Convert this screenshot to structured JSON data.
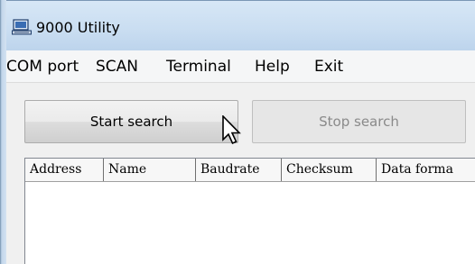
{
  "window": {
    "title": "9000 Utility"
  },
  "menu": {
    "items": [
      {
        "label": "COM port"
      },
      {
        "label": "SCAN"
      },
      {
        "label": "Terminal"
      },
      {
        "label": "Help"
      },
      {
        "label": "Exit"
      }
    ]
  },
  "toolbar": {
    "start_label": "Start search",
    "stop_label": "Stop search",
    "stop_enabled": false
  },
  "list": {
    "columns": [
      "Address",
      "Name",
      "Baudrate",
      "Checksum",
      "Data forma"
    ],
    "rows": []
  },
  "icons": {
    "app": "computer-icon",
    "cursor": "mouse-pointer-icon"
  }
}
